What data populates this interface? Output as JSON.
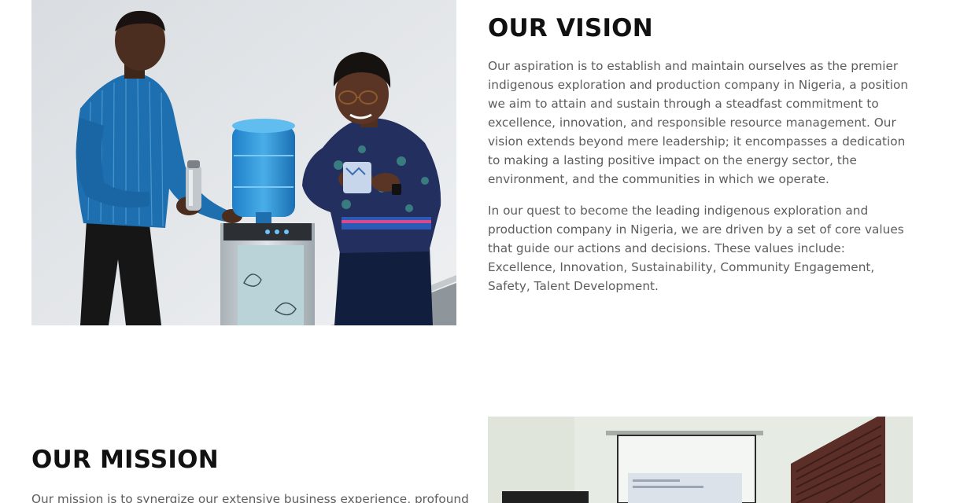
{
  "vision": {
    "title": "OUR VISION",
    "paragraphs": [
      "Our aspiration is to establish and maintain ourselves as the premier indigenous exploration and production company in Nigeria, a position we aim to attain and sustain through a steadfast commitment to excellence, innovation, and responsible resource management. Our vision extends beyond mere leadership; it encompasses a dedication to making a lasting positive impact on the energy sector, the environment, and the communities in which we operate.",
      "In our quest to become the leading indigenous exploration and production company in Nigeria, we are driven by a set of core values that guide our actions and decisions. These values include: Excellence, Innovation, Sustainability, Community Engagement, Safety, Talent Development."
    ]
  },
  "mission": {
    "title": "OUR MISSION",
    "paragraphs": [
      "Our mission is to synergize our extensive business experience, profound"
    ]
  },
  "colors": {
    "heading": "#111111",
    "body_text": "#5d5d5d",
    "background": "#ffffff"
  }
}
